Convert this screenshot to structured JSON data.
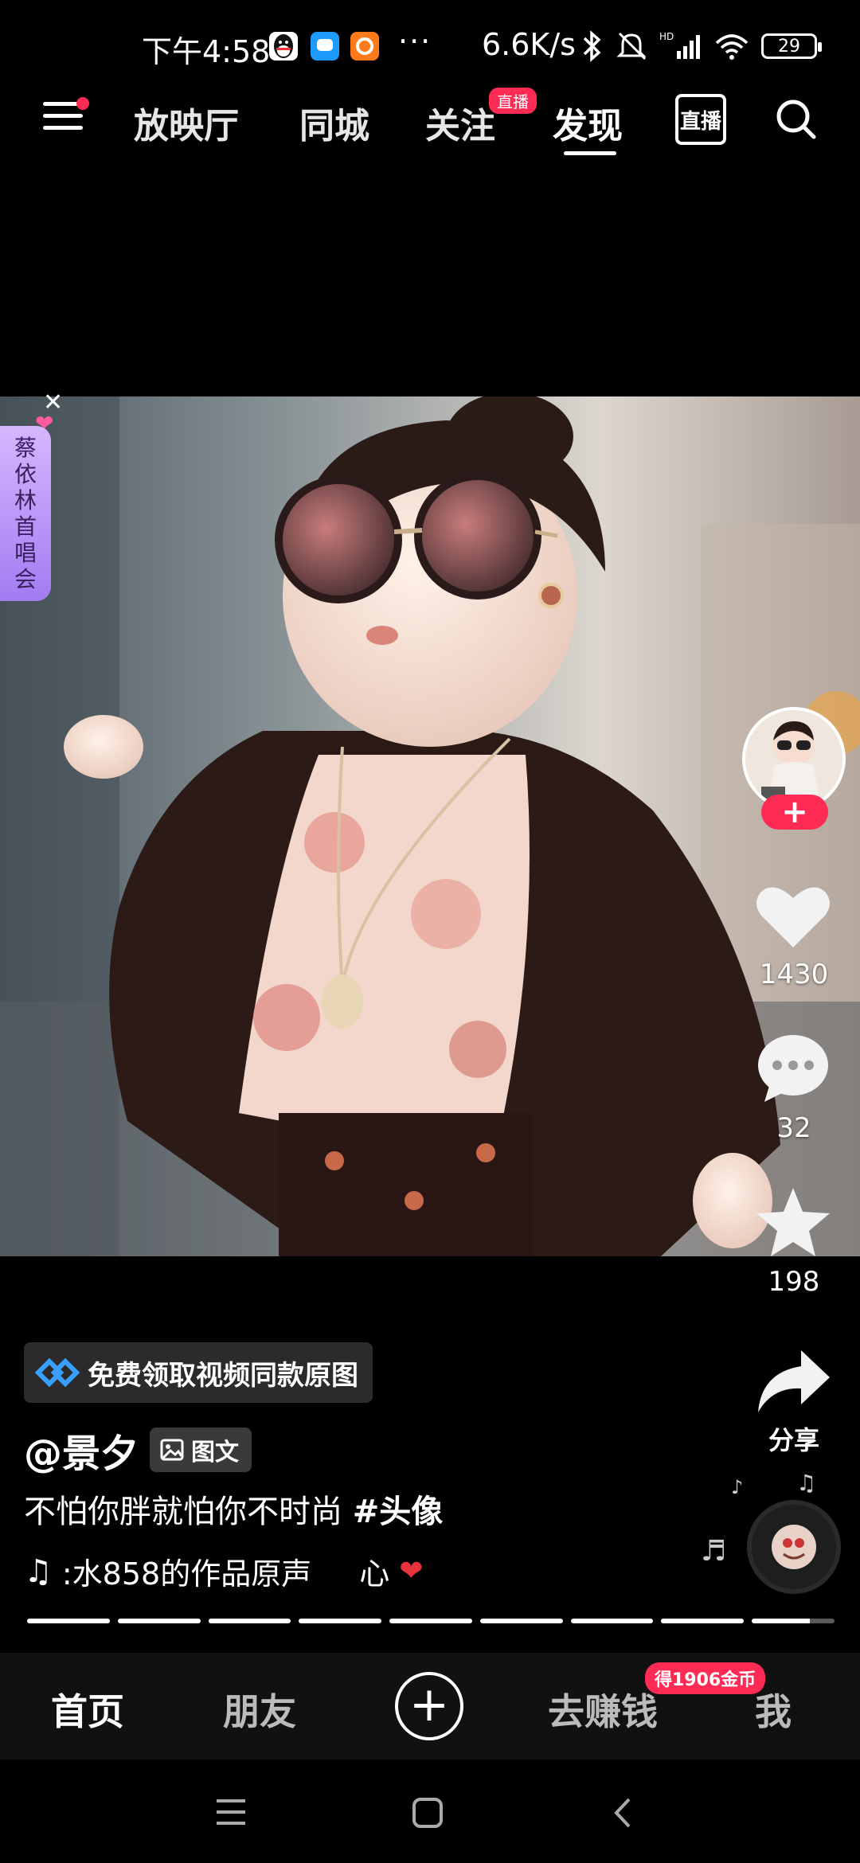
{
  "status_bar": {
    "time": "下午4:58",
    "app_icons": [
      "qq-icon",
      "chat-bubble-icon",
      "orange-app-icon"
    ],
    "more": "···",
    "net_speed": "6.6K/s",
    "battery": "29"
  },
  "top_nav": {
    "tabs": [
      {
        "label": "放映厅"
      },
      {
        "label": "同城"
      },
      {
        "label": "关注",
        "badge": "直播"
      },
      {
        "label": "发现",
        "active": true
      }
    ],
    "live_icon_label": "直播"
  },
  "concert_badge": {
    "chars": [
      "蔡",
      "依",
      "林",
      "首",
      "唱",
      "会"
    ]
  },
  "right_rail": {
    "likes": "1430",
    "comments": "32",
    "favorites": "198",
    "share_label": "分享",
    "follow_symbol": "+"
  },
  "post": {
    "promo": "免费领取视频同款原图",
    "author": "@景夕",
    "type_tag": "图文",
    "caption_text": "不怕你胖就怕你不时尚 ",
    "hashtag": "#头像",
    "music": ":水858的作品原声",
    "music_suffix": "心"
  },
  "progress": {
    "segments": 9,
    "current_fill": 0.7
  },
  "tab_bar": {
    "home": "首页",
    "friends": "朋友",
    "add": "+",
    "earn": "去赚钱",
    "me": "我",
    "coin_badge": "得1906金币"
  },
  "colors": {
    "accent": "#fe2c55",
    "background": "#000000"
  }
}
